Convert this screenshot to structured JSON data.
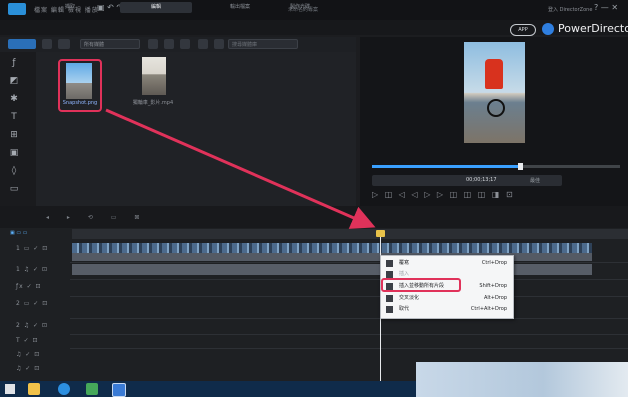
{
  "app": {
    "menu": "檔案  編輯  檢視  播放",
    "quick_access": "▣ ↶ ↷ ▭ ⚙",
    "project_title": "未命名的專案",
    "user": "登入 DirectorZone",
    "window_controls": "? — ✕",
    "badge": "APP",
    "brand": "PowerDirector"
  },
  "modes": {
    "capture": "擷取",
    "edit": "編輯",
    "produce": "輸出檔案",
    "disc": "製作光碟"
  },
  "library": {
    "media_dropdown": "所有媒體",
    "search_placeholder": "搜尋媒體庫",
    "items": [
      {
        "filename": "Snapshot.png",
        "selected": true
      },
      {
        "filename": "獨輪車_影片.mp4",
        "selected": false
      }
    ]
  },
  "preview": {
    "timecode": "00;00;13;17",
    "quality": "最佳",
    "seek_progress": 0.6,
    "controls": "▷ ◫ ◁ ◁ ▷ ▷ ◫ ◫ ◫ ◨ ⊡"
  },
  "timeline": {
    "buttons": "▣ ▭ ▭",
    "tracks": [
      "1 ▭ ✓ ⊡",
      "1 ♫ ✓ ⊡",
      "ƒx ✓ ⊡",
      "2 ▭ ✓ ⊡",
      "2 ♫ ✓ ⊡",
      "T ✓ ⊡",
      "♫ ✓ ⊡",
      "♫ ✓ ⊡"
    ],
    "mid_icons": "◂ ▸ ⟲ ▭ ⊠"
  },
  "context_menu": {
    "items": [
      {
        "label": "覆寫",
        "shortcut": "Ctrl+Drop",
        "enabled": true
      },
      {
        "label": "插入",
        "shortcut": "",
        "enabled": false
      },
      {
        "label": "插入並移動所有片段",
        "shortcut": "Shift+Drop",
        "enabled": true
      },
      {
        "label": "交叉淡化",
        "shortcut": "Alt+Drop",
        "enabled": true
      },
      {
        "label": "取代",
        "shortcut": "Ctrl+Alt+Drop",
        "enabled": true
      }
    ]
  },
  "colors": {
    "accent": "#2f8fe8",
    "highlight": "#e0325a",
    "arrow": "#e0325a"
  },
  "taskbar": {
    "icons": [
      "file-explorer-icon",
      "internet-explorer-icon",
      "app-icon",
      "powerdirector-icon"
    ]
  }
}
